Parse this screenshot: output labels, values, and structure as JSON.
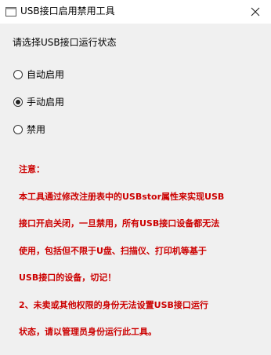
{
  "window": {
    "title": "USB接口启用禁用工具"
  },
  "prompt": "请选择USB接口运行状态",
  "options": [
    {
      "label": "自动启用",
      "selected": false
    },
    {
      "label": "手动启用",
      "selected": true
    },
    {
      "label": "禁用",
      "selected": false
    }
  ],
  "notice": {
    "lines": [
      "注意：",
      "本工具通过修改注册表中的USBstor属性来实现USB",
      "接口开启关闭，一旦禁用，所有USB接口设备都无法",
      "使用，包括但不限于U盘、扫描仪、打印机等基于",
      "USB接口的设备，切记！",
      "2、未卖或其他权限的身份无法设置USB接口运行",
      "状态，请以管理员身份运行此工具。"
    ],
    "color": "#cc0000"
  }
}
